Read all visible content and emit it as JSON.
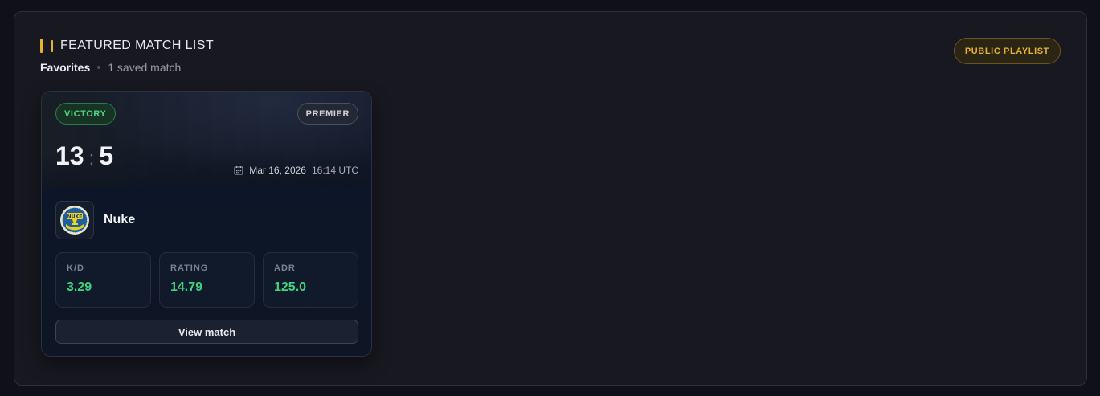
{
  "header": {
    "title": "FEATURED MATCH LIST",
    "collection_name": "Favorites",
    "count_label": "1 saved match"
  },
  "playlist_badge": "PUBLIC PLAYLIST",
  "match": {
    "result": "VICTORY",
    "mode": "PREMIER",
    "score_team": "13",
    "score_separator": ":",
    "score_enemy": "5",
    "date": "Mar 16, 2026",
    "time": "16:14 UTC",
    "map_name": "Nuke",
    "map_logo_text": "NUKE",
    "stats": [
      {
        "label": "K/D",
        "value": "3.29"
      },
      {
        "label": "RATING",
        "value": "14.79"
      },
      {
        "label": "ADR",
        "value": "125.0"
      }
    ],
    "view_button": "View match"
  },
  "colors": {
    "accent": "#e8b22e",
    "victory": "#4ed38a",
    "stat_value": "#3fd37e"
  },
  "icons": [
    "calendar-icon",
    "nuke-map-icon"
  ]
}
